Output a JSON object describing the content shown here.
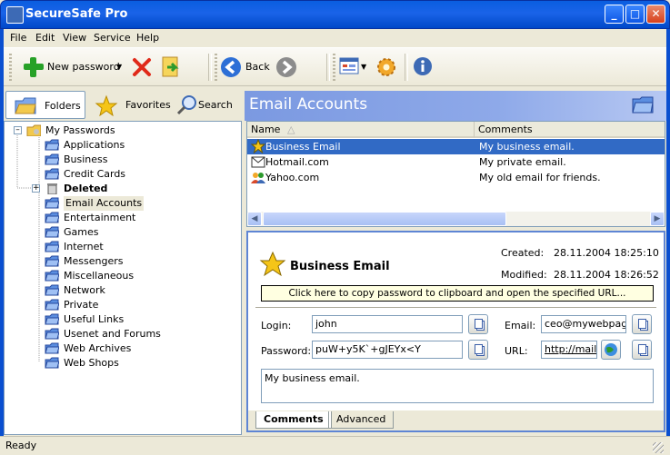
{
  "window": {
    "title": "SecureSafe Pro",
    "minimize": "_",
    "maximize": "□",
    "close": "✕"
  },
  "menu": [
    "File",
    "Edit",
    "View",
    "Service",
    "Help"
  ],
  "toolbar": {
    "new_password": "New password",
    "back": "Back"
  },
  "left_tabs": {
    "folders": "Folders",
    "favorites": "Favorites",
    "search": "Search"
  },
  "tree": {
    "root": "My Passwords",
    "items": [
      "Applications",
      "Business",
      "Credit Cards",
      "Deleted",
      "Email Accounts",
      "Entertainment",
      "Games",
      "Internet",
      "Messengers",
      "Miscellaneous",
      "Network",
      "Private",
      "Useful Links",
      "Usenet and Forums",
      "Web Archives",
      "Web Shops"
    ],
    "selected": "Email Accounts"
  },
  "folder_header": {
    "title": "Email Accounts"
  },
  "list": {
    "columns": [
      "Name",
      "Comments"
    ],
    "rows": [
      {
        "name": "Business Email",
        "comment": "My business email."
      },
      {
        "name": "Hotmail.com",
        "comment": "My private email."
      },
      {
        "name": "Yahoo.com",
        "comment": "My old email for friends."
      }
    ]
  },
  "detail": {
    "title": "Business Email",
    "created_label": "Created:",
    "created": "28.11.2004 18:25:10",
    "modified_label": "Modified:",
    "modified": "28.11.2004 18:26:52",
    "copy_hint": "Click here to copy password to clipboard and open the specified URL...",
    "login_label": "Login:",
    "login": "john",
    "password_label": "Password:",
    "password": "puW+y5K`+gJEYx<Y",
    "email_label": "Email:",
    "email": "ceo@mywebpage",
    "url_label": "URL:",
    "url": "http://mail.",
    "comment": "My business email.",
    "tabs": [
      "Comments",
      "Advanced"
    ]
  },
  "status": "Ready"
}
